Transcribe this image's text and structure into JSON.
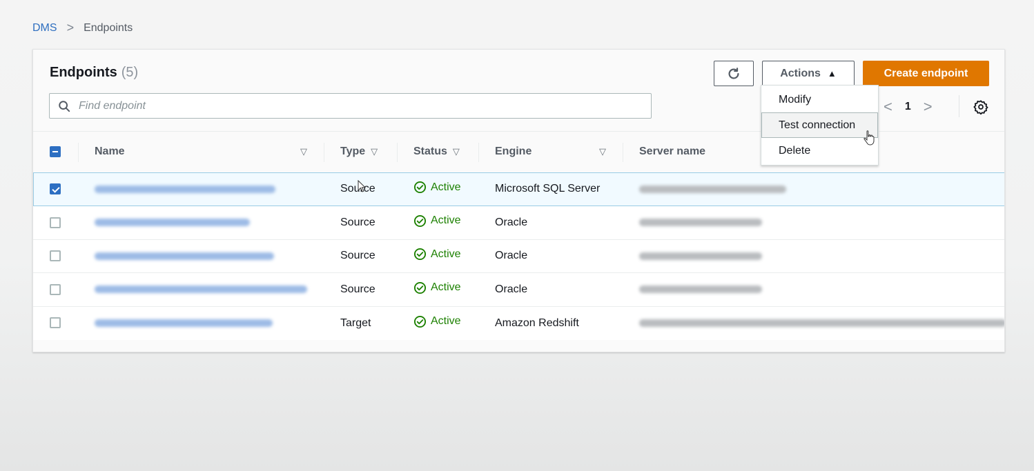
{
  "breadcrumb": {
    "parent": "DMS",
    "separator": ">",
    "current": "Endpoints"
  },
  "panel": {
    "title": "Endpoints",
    "count": "(5)"
  },
  "search": {
    "placeholder": "Find endpoint",
    "value": "",
    "icon": "search-icon"
  },
  "toolbar": {
    "refresh_icon": "refresh-icon",
    "actions_label": "Actions",
    "actions_caret": "▲",
    "create_label": "Create endpoint",
    "create_color": "#e07700"
  },
  "actions_menu": {
    "open": true,
    "items": [
      {
        "label": "Modify",
        "hovered": false
      },
      {
        "label": "Test connection",
        "hovered": true
      },
      {
        "label": "Delete",
        "hovered": false
      }
    ]
  },
  "pagination": {
    "prev": "<",
    "current_page": "1",
    "next": ">",
    "settings_icon": "gear-icon"
  },
  "table": {
    "select_all_state": "indeterminate",
    "columns": [
      {
        "label": "Name",
        "sortable": true
      },
      {
        "label": "Type",
        "sortable": true
      },
      {
        "label": "Status",
        "sortable": true
      },
      {
        "label": "Engine",
        "sortable": true
      },
      {
        "label": "Server name",
        "sortable": false
      }
    ],
    "rows": [
      {
        "selected": true,
        "name": "[redacted]",
        "type": "Source",
        "status": "Active",
        "engine": "Microsoft SQL Server",
        "server_name": "[redacted]"
      },
      {
        "selected": false,
        "name": "[redacted]",
        "type": "Source",
        "status": "Active",
        "engine": "Oracle",
        "server_name": "[redacted]"
      },
      {
        "selected": false,
        "name": "[redacted]",
        "type": "Source",
        "status": "Active",
        "engine": "Oracle",
        "server_name": "[redacted]"
      },
      {
        "selected": false,
        "name": "[redacted]",
        "type": "Source",
        "status": "Active",
        "engine": "Oracle",
        "server_name": "[redacted]"
      },
      {
        "selected": false,
        "name": "[redacted]",
        "type": "Target",
        "status": "Active",
        "engine": "Amazon Redshift",
        "server_name": "[redacted]"
      }
    ],
    "status_color": "#1d8102",
    "link_color": "#2f6fc0"
  },
  "scrollbar": {
    "horizontal_position": 0,
    "visible_fraction": 0.48
  }
}
